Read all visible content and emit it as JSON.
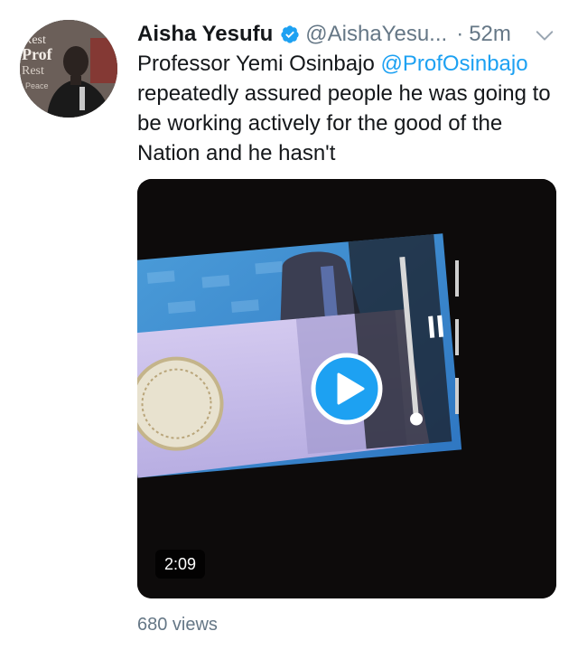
{
  "tweet": {
    "author_name": "Aisha Yesufu",
    "handle": "@AishaYesu...",
    "separator": "·",
    "time": "52m",
    "text_prefix": "Professor Yemi Osinbajo ",
    "mention": "@ProfOsinbajo",
    "text_suffix": " repeatedly assured people he was going to be working actively for the good of the Nation and he hasn't",
    "video_duration": "2:09",
    "views": "680 views"
  },
  "avatar": {
    "sign_words": [
      "Rest",
      "Prof",
      "Rest",
      "Peace"
    ]
  },
  "icons": {
    "verified": "verified-badge-icon",
    "menu": "chevron-down-icon",
    "play": "play-icon"
  },
  "colors": {
    "accent": "#1da1f2",
    "text": "#14171a",
    "muted": "#657786"
  }
}
